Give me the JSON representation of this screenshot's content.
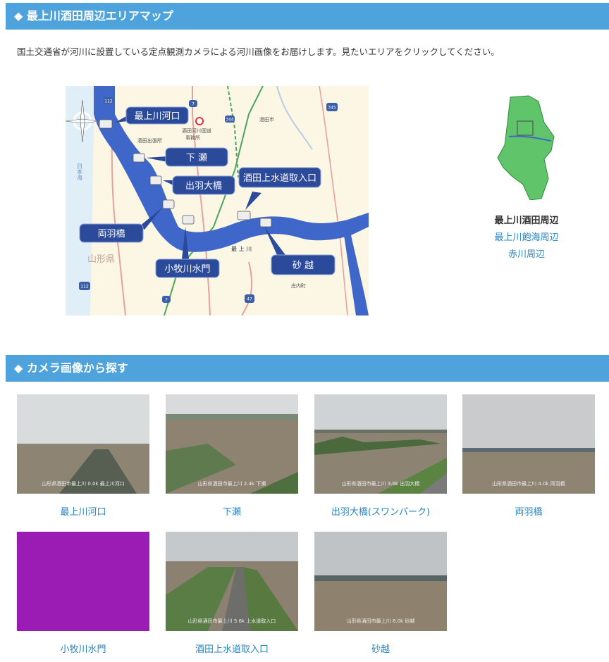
{
  "map_section": {
    "title": "◆ 最上川酒田周辺エリアマップ"
  },
  "intro": "国土交通省が河川に設置している定点観測カメラによる河川画像をお届けします。見たいエリアをクリックしてください。",
  "map": {
    "labels": {
      "kakou": "最上川河口",
      "shimose": "下 瀬",
      "dewa": "出羽大橋",
      "josui": "酒田上水道取入口",
      "ryouha": "両羽橋",
      "komaki": "小牧川水門",
      "isago": "砂 越",
      "sakata_city": "酒田市",
      "office": "酒田河川国道",
      "office2": "事務所",
      "branch": "酒田出張所",
      "yamagata": "山形県",
      "sea": "日本海",
      "river": "最 上 川",
      "shonai": "庄内町"
    },
    "routes": {
      "r112a": "112",
      "r7a": "7",
      "r344": "344",
      "r345": "345",
      "r112b": "112",
      "r7b": "7",
      "r47": "47"
    }
  },
  "area_links": {
    "current": "最上川酒田周辺",
    "link1": "最上川飽海周辺",
    "link2": "赤川周辺"
  },
  "camera_section": {
    "title": "◆ カメラ画像から探す"
  },
  "cameras": [
    {
      "caption": "最上川河口",
      "stamp": "山形県酒田市最上川 0.0k 最上川河口"
    },
    {
      "caption": "下瀬",
      "stamp": "山形県酒田市最上川 2.4k 下瀬"
    },
    {
      "caption": "出羽大橋(スワンパーク)",
      "stamp": "山形県酒田市最上川 3.6k 出羽大橋"
    },
    {
      "caption": "両羽橋",
      "stamp": "山形県酒田市最上川 4.0k 両羽橋"
    },
    {
      "caption": "小牧川水門",
      "stamp": ""
    },
    {
      "caption": "酒田上水道取入口",
      "stamp": "山形県酒田市最上川 5.6k 上水道取入口"
    },
    {
      "caption": "砂越",
      "stamp": "山形県酒田市最上川 8.0k 砂越"
    }
  ],
  "colors": {
    "accent": "#4fa3dc",
    "link": "#2a86c2",
    "river": "#3f67c9",
    "label_bg": "#2c4a9a",
    "placeholder": "#9b1cb5"
  }
}
